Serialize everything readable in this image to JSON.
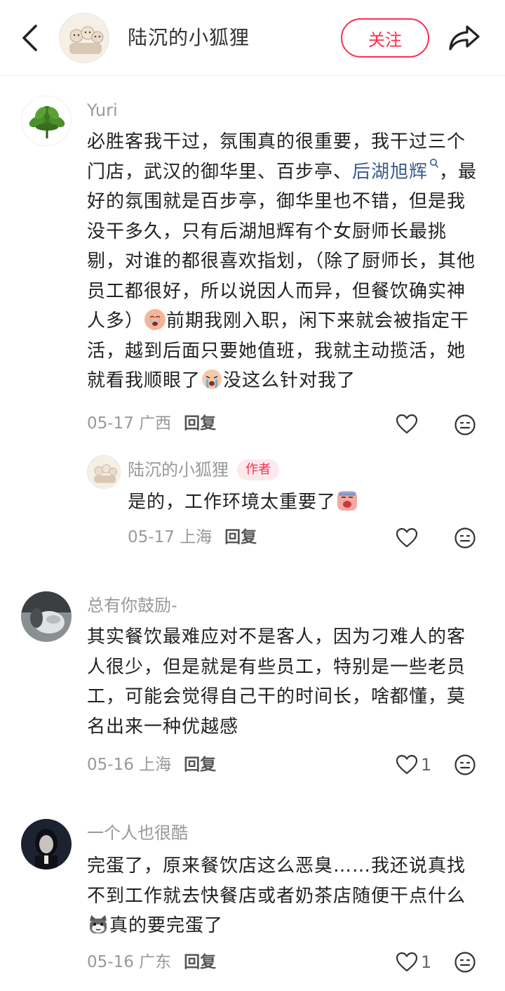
{
  "header": {
    "title": "陆沉的小狐狸",
    "follow_label": "关注"
  },
  "comments": [
    {
      "author": "Yuri",
      "text_before_tag": "必胜客我干过，氛围真的很重要，我干过三个门店，武汉的御华里、百步亭、",
      "hashtag": "后湖旭辉",
      "text_after_tag": "，最好的氛围就是百步亭，御华里也不错，但是我没干多久，只有后湖旭辉有个女厨师长最挑剔，对谁的都很喜欢指划，（除了厨师长，其他员工都很好，所以说因人而异，但餐饮确实神人多）",
      "text_mid": "前期我刚入职，闲下来就会被指定干活，越到后面只要她值班，我就主动揽活，她就看我顺眼了",
      "text_end": "没这么针对我了",
      "date": "05-17",
      "location": "广西",
      "reply_label": "回复",
      "likes": ""
    },
    {
      "author": "陆沉的小狐狸",
      "author_tag": "作者",
      "text": "是的，工作环境太重要了",
      "date": "05-17",
      "location": "上海",
      "reply_label": "回复",
      "likes": ""
    },
    {
      "author": "总有你鼓励-",
      "text": "其实餐饮最难应对不是客人，因为刁难人的客人很少，但是就是有些员工，特别是一些老员工，可能会觉得自己干的时间长，啥都懂，莫名出来一种优越感",
      "date": "05-16",
      "location": "上海",
      "reply_label": "回复",
      "likes": "1"
    },
    {
      "author": "一个人也很酷",
      "text": "完蛋了，原来餐饮店这么恶臭……我还说真找不到工作就去快餐店或者奶茶店随便干点什么",
      "text_end": "真的要完蛋了",
      "date": "05-16",
      "location": "广东",
      "reply_label": "回复",
      "likes": "1"
    }
  ],
  "icons": {
    "back": "chevron-left-icon",
    "share": "share-arrow-icon",
    "like": "heart-outline-icon",
    "emoji": "emoji-face-icon",
    "hashtag_search": "search-icon"
  },
  "colors": {
    "accent": "#ff2e4d",
    "hashtag": "#3b5b8c",
    "meta": "#999999",
    "text": "#222222"
  }
}
